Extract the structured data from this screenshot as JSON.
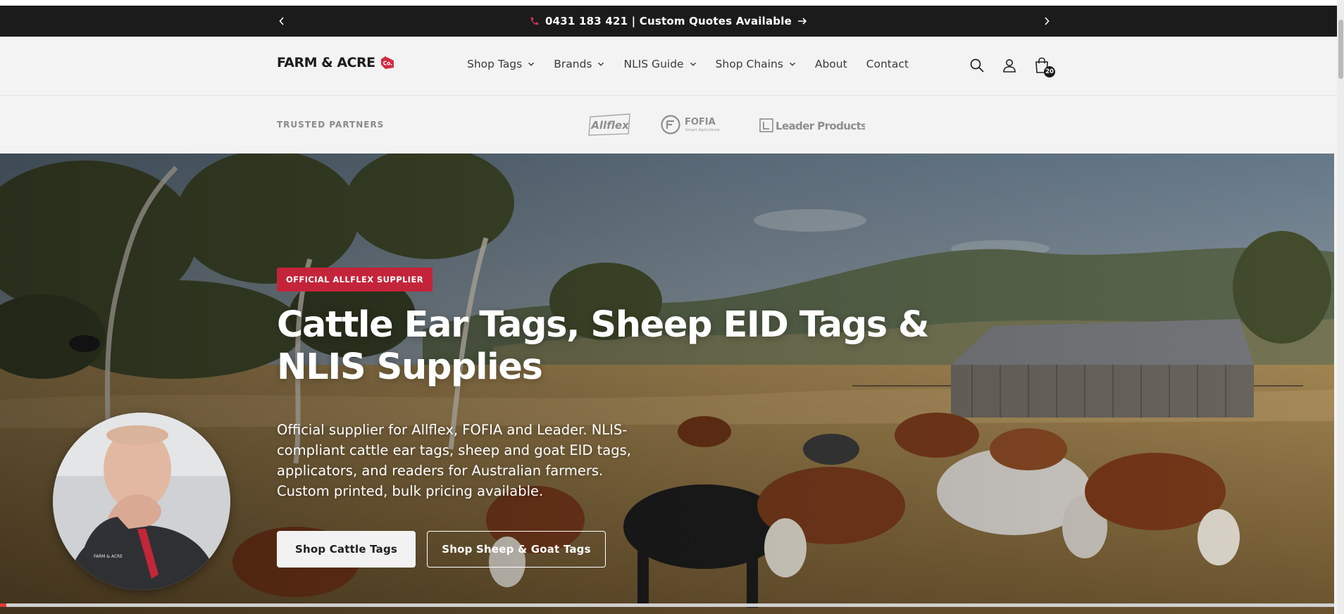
{
  "announcement": {
    "message": "0431 183 421 | Custom Quotes Available",
    "icons": {
      "prev": "chevron-left-icon",
      "next": "chevron-right-icon",
      "phone": "phone-icon",
      "arrow": "arrow-right-icon"
    },
    "phone_icon_color": "#d6335a"
  },
  "header": {
    "logo_text": "FARM & ACRE",
    "logo_badge_text": "Co.",
    "logo_badge_color": "#d32b43",
    "nav": [
      {
        "label": "Shop Tags",
        "has_dropdown": true
      },
      {
        "label": "Brands",
        "has_dropdown": true
      },
      {
        "label": "NLIS Guide",
        "has_dropdown": true
      },
      {
        "label": "Shop Chains",
        "has_dropdown": true
      },
      {
        "label": "About",
        "has_dropdown": false
      },
      {
        "label": "Contact",
        "has_dropdown": false
      }
    ],
    "icons": [
      "search-icon",
      "account-icon",
      "cart-icon"
    ],
    "cart_count": "20"
  },
  "partners": {
    "label": "TRUSTED PARTNERS",
    "logos": [
      {
        "name": "Allflex"
      },
      {
        "name": "FOFIA",
        "tagline": "Smart Agriculture"
      },
      {
        "name": "Leader Products."
      }
    ]
  },
  "hero": {
    "badge": "OFFICIAL ALLFLEX SUPPLIER",
    "badge_color": "#c4243a",
    "title": "Cattle Ear Tags, Sheep EID Tags & NLIS Supplies",
    "subtitle": "Official supplier for Allflex, FOFIA and Leader. NLIS-compliant cattle ear tags, sheep and goat EID tags, applicators, and readers for Australian farmers. Custom printed, bulk pricing available.",
    "primary_button": "Shop Cattle Tags",
    "secondary_button": "Shop Sheep & Goat Tags",
    "video_shirt_text": "FARM & ACRE"
  },
  "slideshow": {
    "progress_fraction": 0.005,
    "progress_color": "#e03a3a"
  }
}
